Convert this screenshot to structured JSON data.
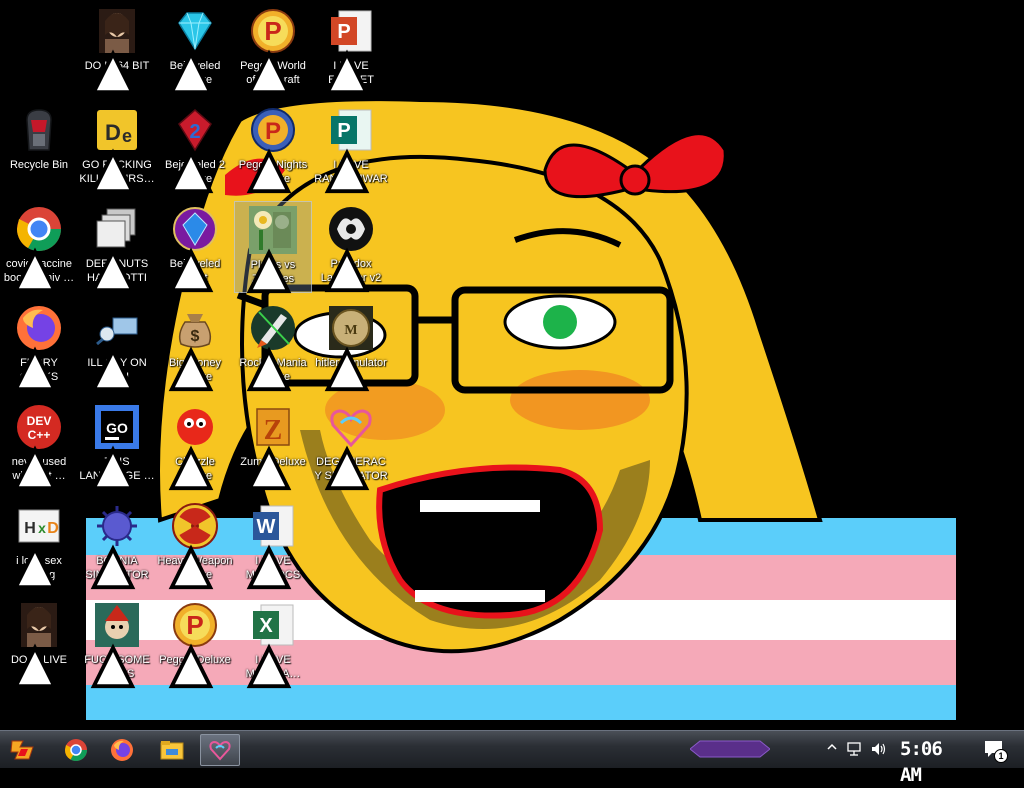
{
  "colors": {
    "taskbar": "#2b2f35",
    "skin": "#f7c520",
    "bow": "#e8121b",
    "eye": "#1db34a",
    "flag_blue": "#5bcefa",
    "flag_pink": "#f5a9b8",
    "flag_white": "#ffffff"
  },
  "desktop": {
    "icons": [
      {
        "label": "DO IT 64 BIT",
        "icon": "painting-portrait-icon"
      },
      {
        "label": "Bejeweled Deluxe",
        "icon": "diamond-gem-icon"
      },
      {
        "label": "Peggle World of Warcraft Edition",
        "icon": "peggle-icon"
      },
      {
        "label": "I LOVE EMOTET",
        "icon": "powerpoint-icon"
      },
      {
        "label": "Recycle Bin",
        "icon": "recycle-bin-icon"
      },
      {
        "label": "GO FUCKING KILL YOURS…",
        "icon": "de-app-icon"
      },
      {
        "label": "Bejeweled 2 Deluxe",
        "icon": "bejeweled2-icon"
      },
      {
        "label": "Peggle Nights Deluxe",
        "icon": "peggle-nights-icon"
      },
      {
        "label": "I LOVE RANSOMWARE",
        "icon": "publisher-icon"
      },
      {
        "label": "covid vaccine boosted hiv …",
        "icon": "chrome-icon"
      },
      {
        "label": "DEEZ NUTS HAH GOTTI",
        "icon": "windows-stack-icon"
      },
      {
        "label": "Bejeweled Twist",
        "icon": "bejeweled-twist-icon"
      },
      {
        "label": "Plants vs Zombies",
        "icon": "plants-vs-zombies-icon"
      },
      {
        "label": "Paradox Launcher v2",
        "icon": "paradox-icon"
      },
      {
        "label": "FURRY CUCKS",
        "icon": "firefox-icon"
      },
      {
        "label": "ILL SPY ON YOU",
        "icon": "network-spy-icon"
      },
      {
        "label": "Big Money Deluxe",
        "icon": "money-bag-icon"
      },
      {
        "label": "Rocket Mania Deluxe",
        "icon": "rocket-icon"
      },
      {
        "label": "hitler simulator",
        "icon": "game-coin-icon"
      },
      {
        "label": "never used why is it …",
        "icon": "devcpp-icon"
      },
      {
        "label": "THIS LANGUAGE …",
        "icon": "goland-icon"
      },
      {
        "label": "Chuzzle Deluxe",
        "icon": "chuzzle-icon"
      },
      {
        "label": "Zuma Deluxe",
        "icon": "zuma-icon"
      },
      {
        "label": "DEGENERACY SIMULATOR",
        "icon": "heart-mascot-icon"
      },
      {
        "label": "i love sex editing",
        "icon": "hxd-icon"
      },
      {
        "label": "BOSNIA SIMULATOR",
        "icon": "naval-mine-icon"
      },
      {
        "label": "Heavy Weapon Deluxe",
        "icon": "radiation-icon"
      },
      {
        "label": "I LOVE MALDOCS",
        "icon": "word-icon"
      },
      {
        "label": "DO IT LIVE",
        "icon": "painting-portrait-icon"
      },
      {
        "label": "FUCK SOME ELVES",
        "icon": "elf-game-icon"
      },
      {
        "label": "Peggle Deluxe",
        "icon": "peggle-icon"
      },
      {
        "label": "I LOVE MALSPA…",
        "icon": "excel-icon"
      }
    ]
  },
  "taskbar": {
    "buttons": [
      {
        "icon": "start-logo-icon"
      },
      {
        "icon": "chrome-icon"
      },
      {
        "icon": "firefox-icon"
      },
      {
        "icon": "file-explorer-icon"
      },
      {
        "icon": "heart-mascot-icon",
        "active": true
      }
    ],
    "tray": {
      "icons": [
        "chevron-up-icon",
        "network-icon",
        "volume-icon"
      ],
      "clock": "5:06 AM",
      "notification_count": "1"
    }
  }
}
